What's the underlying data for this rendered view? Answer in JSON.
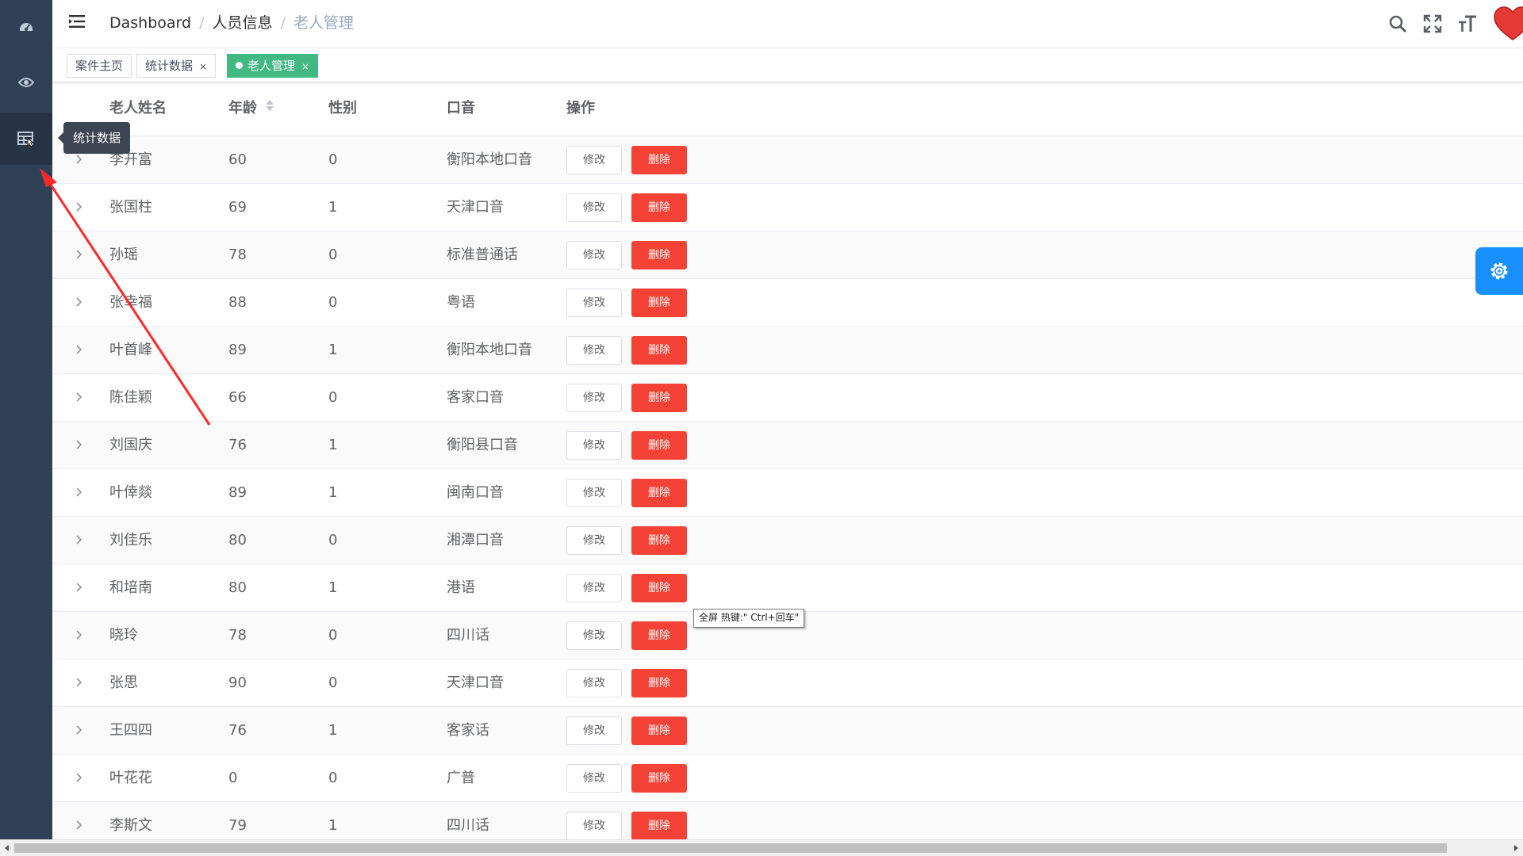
{
  "sidebar": {
    "tooltip": "统计数据"
  },
  "navbar": {
    "breadcrumb": [
      "Dashboard",
      "人员信息",
      "老人管理"
    ],
    "separator": "/"
  },
  "tags": [
    {
      "label": "案件主页",
      "closable": false,
      "active": false
    },
    {
      "label": "统计数据",
      "closable": true,
      "active": false
    },
    {
      "label": "老人管理",
      "closable": true,
      "active": true
    }
  ],
  "tag_close": "×",
  "table": {
    "headers": {
      "name": "老人姓名",
      "age": "年龄",
      "gender": "性别",
      "accent": "口音",
      "actions": "操作"
    },
    "edit_label": "修改",
    "delete_label": "删除",
    "rows": [
      {
        "name": "李开富",
        "age": "60",
        "gender": "0",
        "accent": "衡阳本地口音"
      },
      {
        "name": "张国柱",
        "age": "69",
        "gender": "1",
        "accent": "天津口音"
      },
      {
        "name": "孙瑶",
        "age": "78",
        "gender": "0",
        "accent": "标准普通话"
      },
      {
        "name": "张幸福",
        "age": "88",
        "gender": "0",
        "accent": "粤语"
      },
      {
        "name": "叶首峰",
        "age": "89",
        "gender": "1",
        "accent": "衡阳本地口音"
      },
      {
        "name": "陈佳颖",
        "age": "66",
        "gender": "0",
        "accent": "客家口音"
      },
      {
        "name": "刘国庆",
        "age": "76",
        "gender": "1",
        "accent": "衡阳县口音"
      },
      {
        "name": "叶倖燚",
        "age": "89",
        "gender": "1",
        "accent": "闽南口音"
      },
      {
        "name": "刘佳乐",
        "age": "80",
        "gender": "0",
        "accent": "湘潭口音"
      },
      {
        "name": "和培南",
        "age": "80",
        "gender": "1",
        "accent": "港语"
      },
      {
        "name": "晓玲",
        "age": "78",
        "gender": "0",
        "accent": "四川话"
      },
      {
        "name": "张思",
        "age": "90",
        "gender": "0",
        "accent": "天津口音"
      },
      {
        "name": "王四四",
        "age": "76",
        "gender": "1",
        "accent": "客家话"
      },
      {
        "name": "叶花花",
        "age": "0",
        "gender": "0",
        "accent": "广普"
      },
      {
        "name": "李斯文",
        "age": "79",
        "gender": "1",
        "accent": "四川话"
      }
    ]
  },
  "fullscreen_tooltip": "全屏 热键:\" Ctrl+回车\"",
  "colors": {
    "sidebar": "#304156",
    "tag_active": "#42b983",
    "delete": "#f44336",
    "settings": "#1890ff",
    "annotation_arrow": "#ff0000"
  },
  "icons": [
    "dashboard-icon",
    "eye-icon",
    "table-icon",
    "hamburger-icon",
    "search-icon",
    "fullscreen-icon",
    "font-size-icon",
    "gear-icon"
  ]
}
